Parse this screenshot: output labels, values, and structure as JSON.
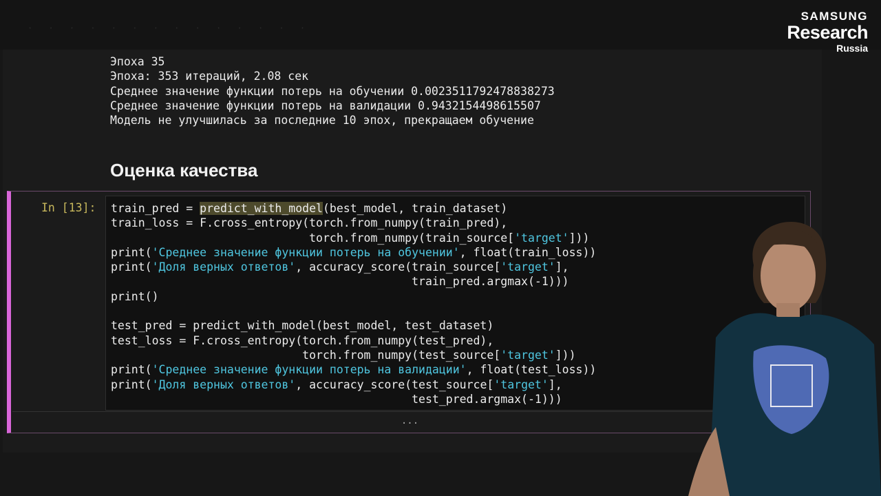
{
  "output": {
    "lines": [
      "Эпоха 35",
      "Эпоха: 353 итераций, 2.08 сек",
      "Среднее значение функции потерь на обучении 0.0023511792478838273",
      "Среднее значение функции потерь на валидации 0.9432154498615507",
      "Модель не улучшилась за последние 10 эпох, прекращаем обучение"
    ]
  },
  "heading": "Оценка качества",
  "cell": {
    "prompt": "In [13]:",
    "code": {
      "l1_var": "train_pred = ",
      "l1_fn": "predict_with_model",
      "l1_args": "(best_model, train_dataset)",
      "l2": "train_loss = F.cross_entropy(torch.from_numpy(train_pred),",
      "l3_a": "                             torch.from_numpy(train_source[",
      "l3_s": "'target'",
      "l3_b": "]))",
      "l4_a": "print(",
      "l4_s": "'Среднее значение функции потерь на обучении'",
      "l4_b": ", float(train_loss))",
      "l5_a": "print(",
      "l5_s": "'Доля верных ответов'",
      "l5_b": ", accuracy_score(train_source[",
      "l5_s2": "'target'",
      "l5_c": "],",
      "l6": "                                            train_pred.argmax(-1)))",
      "l7": "print()",
      "l9": "test_pred = predict_with_model(best_model, test_dataset)",
      "l10": "test_loss = F.cross_entropy(torch.from_numpy(test_pred),",
      "l11_a": "                            torch.from_numpy(test_source[",
      "l11_s": "'target'",
      "l11_b": "]))",
      "l12_a": "print(",
      "l12_s": "'Среднее значение функции потерь на валидации'",
      "l12_b": ", float(test_loss))",
      "l13_a": "print(",
      "l13_s": "'Доля верных ответов'",
      "l13_b": ", accuracy_score(test_source[",
      "l13_s2": "'target'",
      "l13_c": "],",
      "l14": "                                            test_pred.argmax(-1)))"
    },
    "collapsed_output": "..."
  },
  "logo": {
    "line1": "SAMSUNG",
    "line2": "Research",
    "line3": "Russia"
  },
  "colors": {
    "string": "#4fc6e0",
    "prompt": "#c8b85c",
    "cell_border": "#d866d8"
  }
}
